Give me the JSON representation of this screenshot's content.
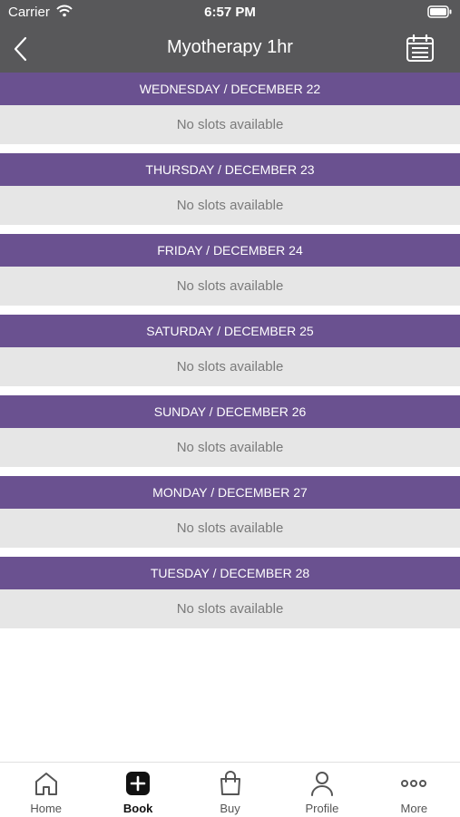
{
  "status_bar": {
    "carrier": "Carrier",
    "time": "6:57 PM"
  },
  "nav": {
    "title": "Myotherapy 1hr"
  },
  "days": [
    {
      "header": "WEDNESDAY / DECEMBER 22",
      "message": "No slots available"
    },
    {
      "header": "THURSDAY / DECEMBER 23",
      "message": "No slots available"
    },
    {
      "header": "FRIDAY / DECEMBER 24",
      "message": "No slots available"
    },
    {
      "header": "SATURDAY / DECEMBER 25",
      "message": "No slots available"
    },
    {
      "header": "SUNDAY / DECEMBER 26",
      "message": "No slots available"
    },
    {
      "header": "MONDAY / DECEMBER 27",
      "message": "No slots available"
    },
    {
      "header": "TUESDAY / DECEMBER 28",
      "message": "No slots available"
    }
  ],
  "tabs": [
    {
      "label": "Home",
      "icon": "home-icon"
    },
    {
      "label": "Book",
      "icon": "plus-square-icon"
    },
    {
      "label": "Buy",
      "icon": "shopping-bag-icon"
    },
    {
      "label": "Profile",
      "icon": "person-icon"
    },
    {
      "label": "More",
      "icon": "more-icon"
    }
  ],
  "colors": {
    "nav_bg": "#58585a",
    "day_header_bg": "#6a5190",
    "day_body_bg": "#e6e6e6",
    "active_tab": "#111111"
  }
}
